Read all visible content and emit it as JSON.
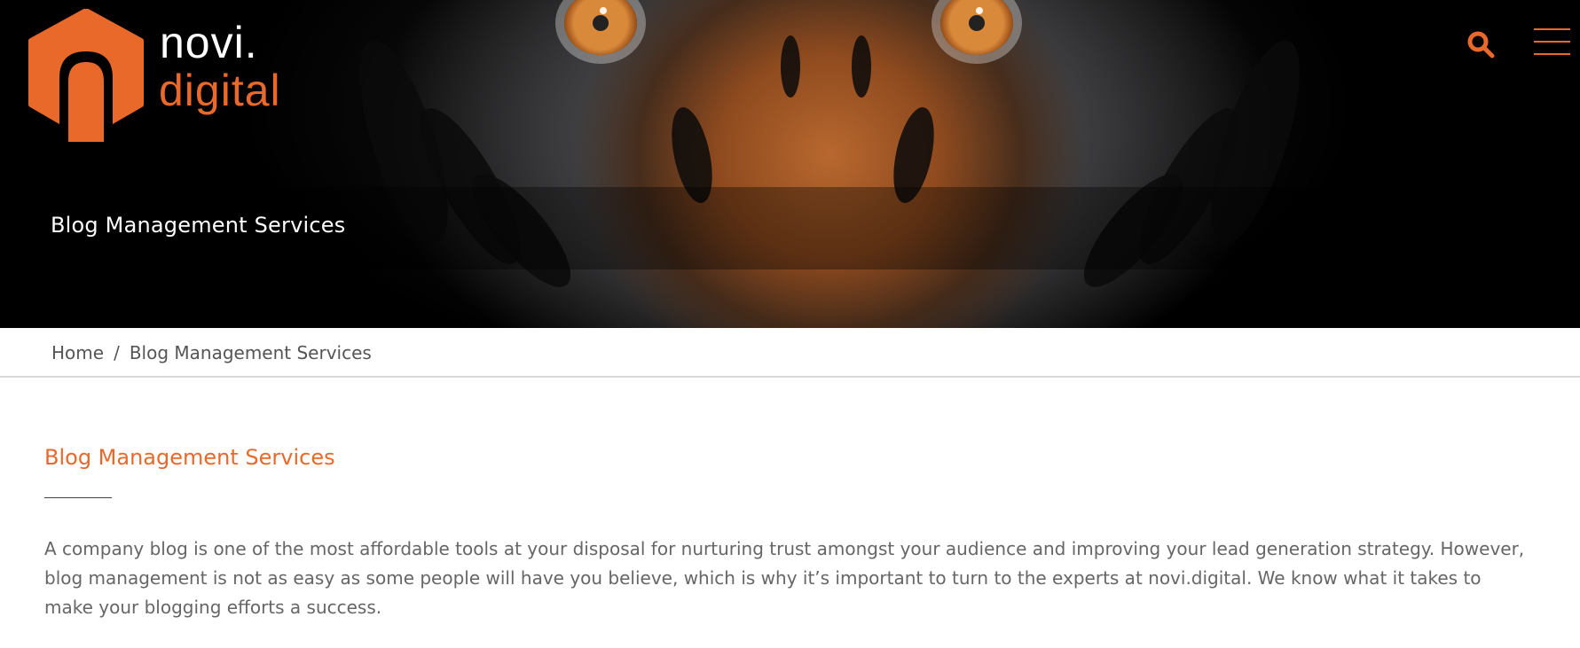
{
  "header": {
    "logo": {
      "line1": "novi.",
      "line2": "digital",
      "brand_color": "#e8692a"
    },
    "search_icon": "search-icon",
    "menu_icon": "hamburger-menu-icon"
  },
  "hero": {
    "title": "Blog Management Services"
  },
  "breadcrumb": {
    "home": "Home",
    "separator": "/",
    "current": "Blog Management Services"
  },
  "content": {
    "heading": "Blog Management Services",
    "body": "A company blog is one of the most affordable tools at your disposal for nurturing trust amongst your audience and improving your lead generation strategy. However, blog management is not as easy as some people will have you believe, which is why it’s important to turn to the experts at novi.digital. We know what it takes to make your blogging efforts a success."
  }
}
